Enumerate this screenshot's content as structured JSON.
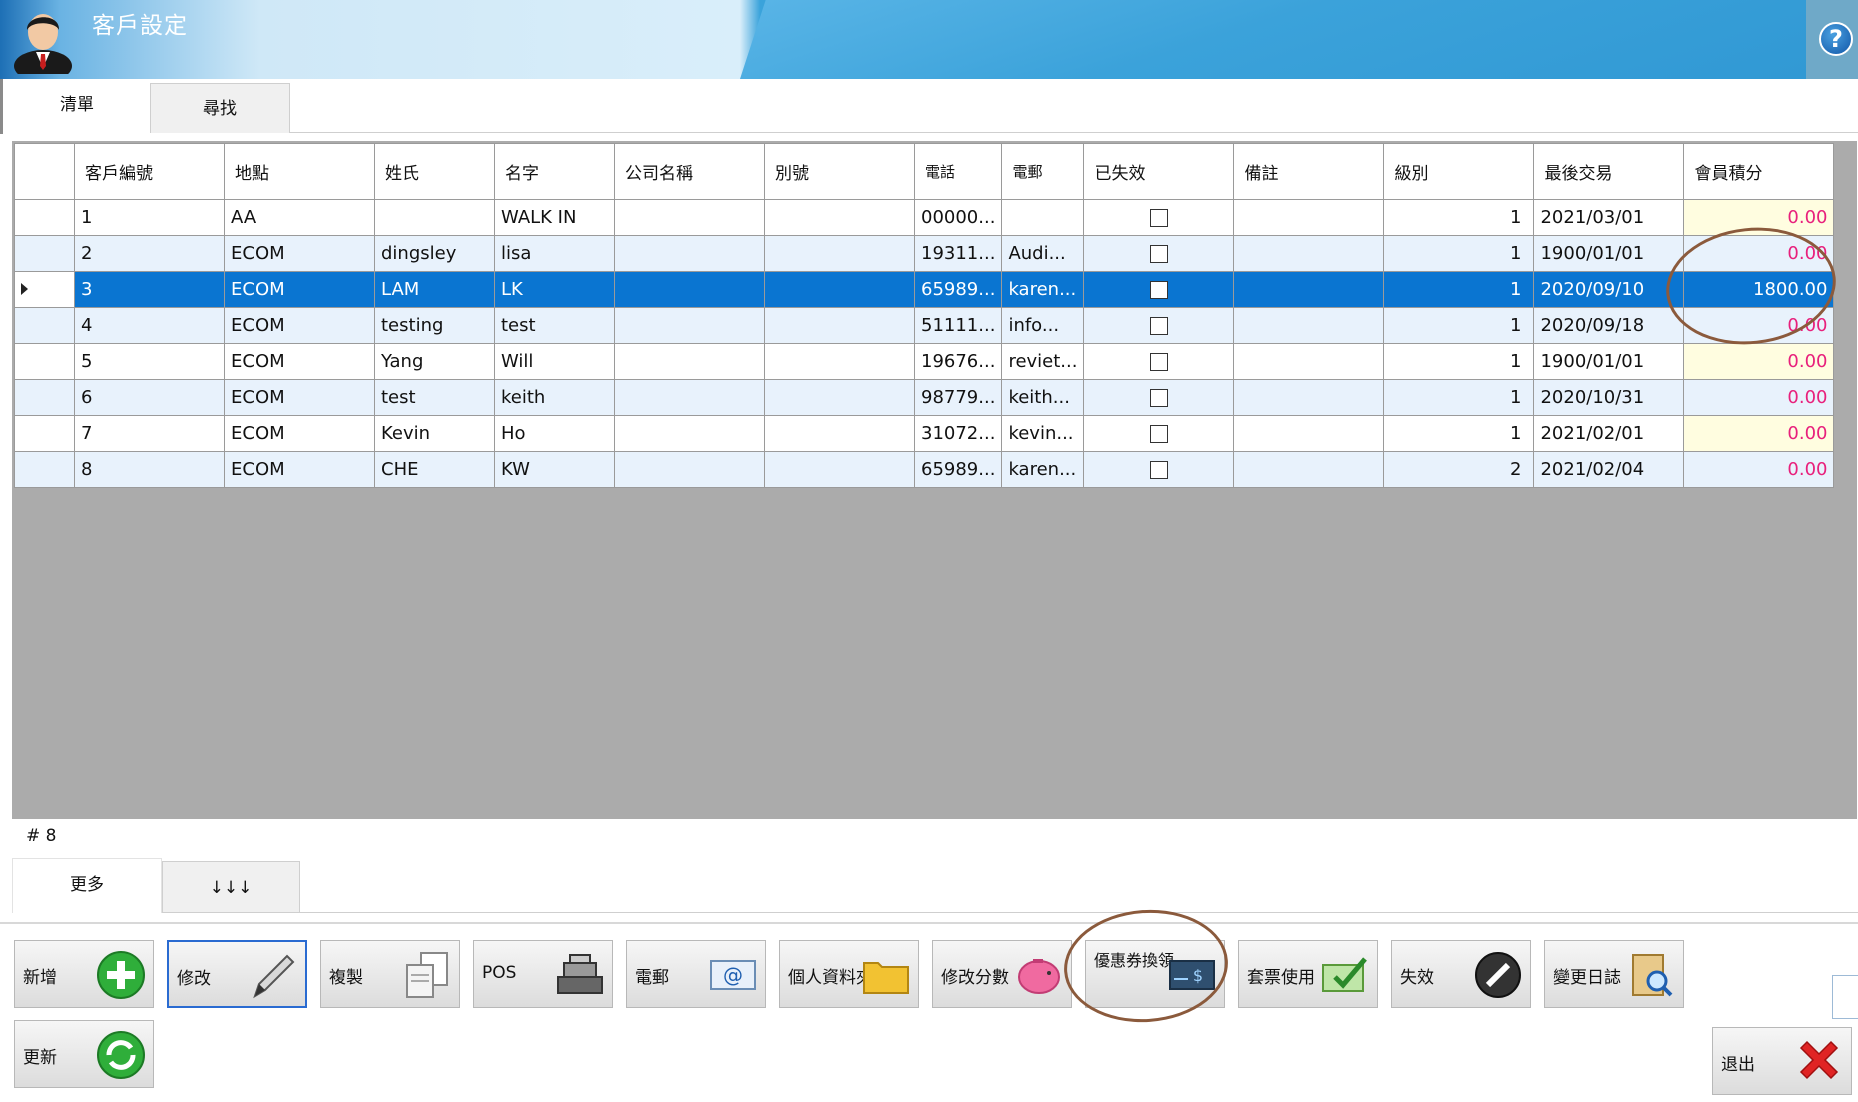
{
  "app": {
    "title": "客戶設定",
    "help": "?"
  },
  "tabs": [
    "清單",
    "尋找"
  ],
  "grid": {
    "columns": [
      "客戶編號",
      "地點",
      "姓氏",
      "名字",
      "公司名稱",
      "別號",
      "電話",
      "電郵",
      "已失效",
      "備註",
      "級別",
      "最後交易",
      "會員積分"
    ],
    "rows": [
      {
        "id": "1",
        "loc": "AA",
        "last": "",
        "first": "WALK IN",
        "company": "",
        "alias": "",
        "phone": "00000...",
        "email": "",
        "level": "1",
        "date": "2021/03/01",
        "points": "0.00"
      },
      {
        "id": "2",
        "loc": "ECOM",
        "last": "dingsley",
        "first": "lisa",
        "company": "",
        "alias": "",
        "phone": "19311...",
        "email": "Audi...",
        "level": "1",
        "date": "1900/01/01",
        "points": "0.00"
      },
      {
        "id": "3",
        "loc": "ECOM",
        "last": "LAM",
        "first": "LK",
        "company": "",
        "alias": "",
        "phone": "65989...",
        "email": "karen...",
        "level": "1",
        "date": "2020/09/10",
        "points": "1800.00"
      },
      {
        "id": "4",
        "loc": "ECOM",
        "last": "testing",
        "first": "test",
        "company": "",
        "alias": "",
        "phone": "51111...",
        "email": "info...",
        "level": "1",
        "date": "2020/09/18",
        "points": "0.00"
      },
      {
        "id": "5",
        "loc": "ECOM",
        "last": "Yang",
        "first": "Will",
        "company": "",
        "alias": "",
        "phone": "19676...",
        "email": "reviet...",
        "level": "1",
        "date": "1900/01/01",
        "points": "0.00"
      },
      {
        "id": "6",
        "loc": "ECOM",
        "last": "test",
        "first": "keith",
        "company": "",
        "alias": "",
        "phone": "98779...",
        "email": "keith...",
        "level": "1",
        "date": "2020/10/31",
        "points": "0.00"
      },
      {
        "id": "7",
        "loc": "ECOM",
        "last": "Kevin",
        "first": "Ho",
        "company": "",
        "alias": "",
        "phone": "31072...",
        "email": "kevin...",
        "level": "1",
        "date": "2021/02/01",
        "points": "0.00"
      },
      {
        "id": "8",
        "loc": "ECOM",
        "last": "CHE",
        "first": "KW",
        "company": "",
        "alias": "",
        "phone": "65989...",
        "email": "karen...",
        "level": "2",
        "date": "2021/02/04",
        "points": "0.00"
      }
    ],
    "selected_row": 3
  },
  "count_label": "# 8",
  "bottom_tabs": [
    "更多",
    "↓↓↓"
  ],
  "toolbar": {
    "add": "新增",
    "edit": "修改",
    "copy": "複製",
    "pos": "POS",
    "email": "電郵",
    "folder": "個人資料夾",
    "points": "修改分數",
    "coupon": "優惠券換領",
    "ticket": "套票使用",
    "disable": "失效",
    "log": "變更日誌",
    "refresh": "更新",
    "exit": "退出"
  },
  "colors": {
    "selection": "#0a75d1",
    "points_text": "#e8207c",
    "annotation": "#8b5a3c"
  }
}
